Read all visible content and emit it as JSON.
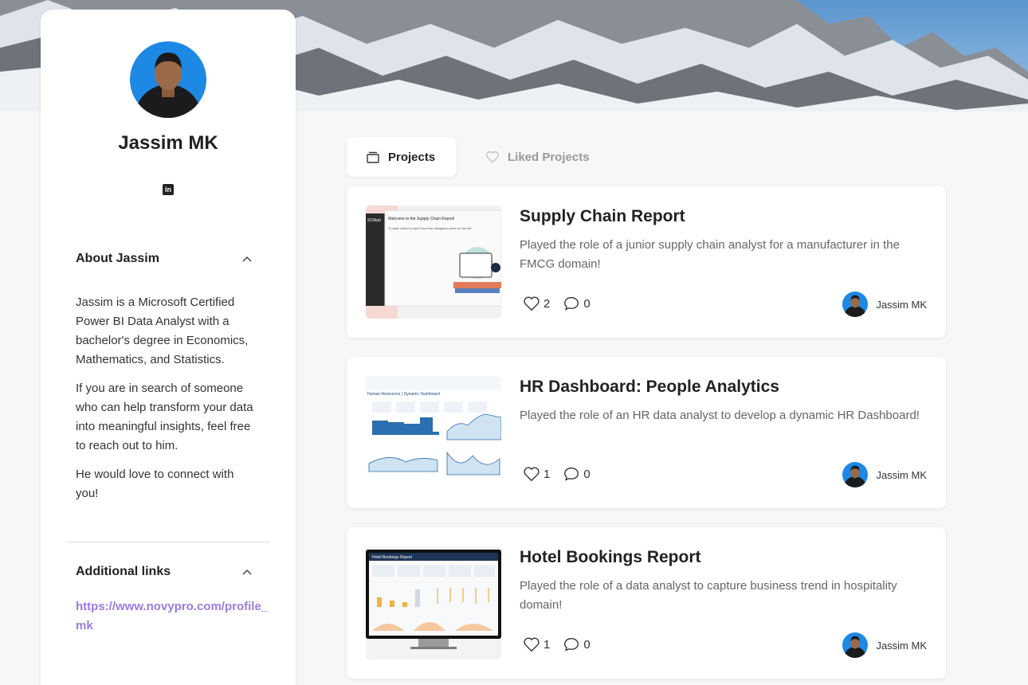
{
  "profile": {
    "name": "Jassim MK",
    "linkedin_label": "in",
    "about_heading": "About Jassim",
    "about_paragraphs": [
      "Jassim is a Microsoft Certified Power BI Data Analyst with a bachelor's degree in Economics, Mathematics, and Statistics.",
      "If you are in search of someone who can help transform your data into meaningful insights, feel free to reach out to him.",
      "He would love to connect with you!"
    ],
    "links_heading": "Additional links",
    "link_url": "https://www.novypro.com/profile_mk"
  },
  "tabs": [
    {
      "label": "Projects",
      "icon": "stack-icon",
      "active": true
    },
    {
      "label": "Liked Projects",
      "icon": "heart-icon",
      "active": false
    }
  ],
  "projects": [
    {
      "title": "Supply Chain Report",
      "description": "Played the role of a junior supply chain analyst for a manufacturer in the FMCG domain!",
      "likes": "2",
      "comments": "0",
      "author": "Jassim MK",
      "thumb": {
        "sidebar_title": "SCMart",
        "heading": "Welcome to the Supply Chain Report!",
        "subheading": "To start, select a report from the navigation pane on the left"
      }
    },
    {
      "title": "HR Dashboard: People Analytics",
      "description": "Played the role of an HR data analyst to develop a dynamic HR Dashboard!",
      "likes": "1",
      "comments": "0",
      "author": "Jassim MK",
      "thumb": {
        "heading": "Human Resources | Dynamic Dashboard"
      }
    },
    {
      "title": "Hotel Bookings Report",
      "description": "Played the role of a data analyst to capture business trend in hospitality domain!",
      "likes": "1",
      "comments": "0",
      "author": "Jassim MK",
      "thumb": {
        "heading": "Hotel Bookings Report"
      }
    }
  ],
  "colors": {
    "accent_link": "#9b7be0",
    "avatar_bg": "#1e88e5"
  }
}
